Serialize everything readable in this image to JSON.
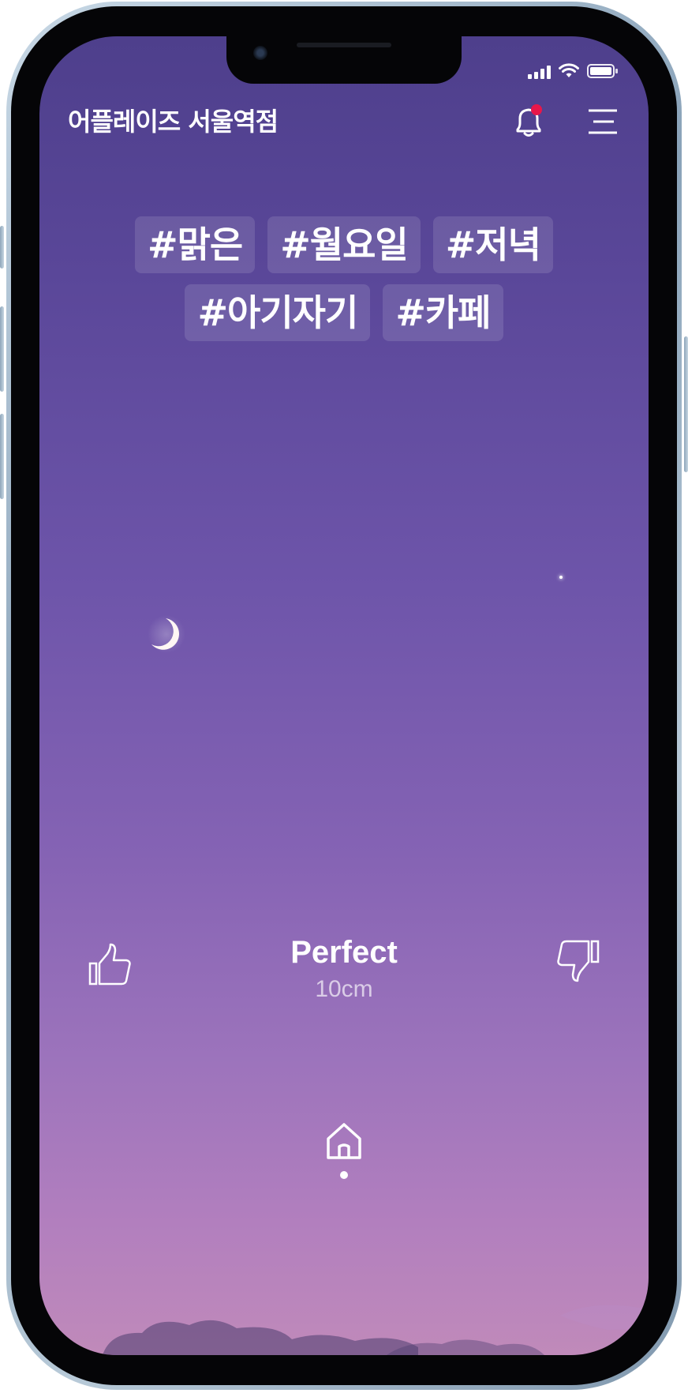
{
  "header": {
    "store_name": "어플레이즈 서울역점",
    "notification_badge_color": "#e8174a"
  },
  "tags": [
    "#맑은",
    "#월요일",
    "#저녁",
    "#아기자기",
    "#카페"
  ],
  "feedback": {
    "title": "Perfect",
    "subtitle": "10cm"
  },
  "icons": {
    "notification": "bell-icon",
    "menu": "menu-icon",
    "like": "thumbs-up-icon",
    "dislike": "thumbs-down-icon",
    "home": "home-icon"
  },
  "colors": {
    "sky_top": "#4e3f8c",
    "sky_bottom": "#c08aba",
    "text": "#ffffff"
  }
}
